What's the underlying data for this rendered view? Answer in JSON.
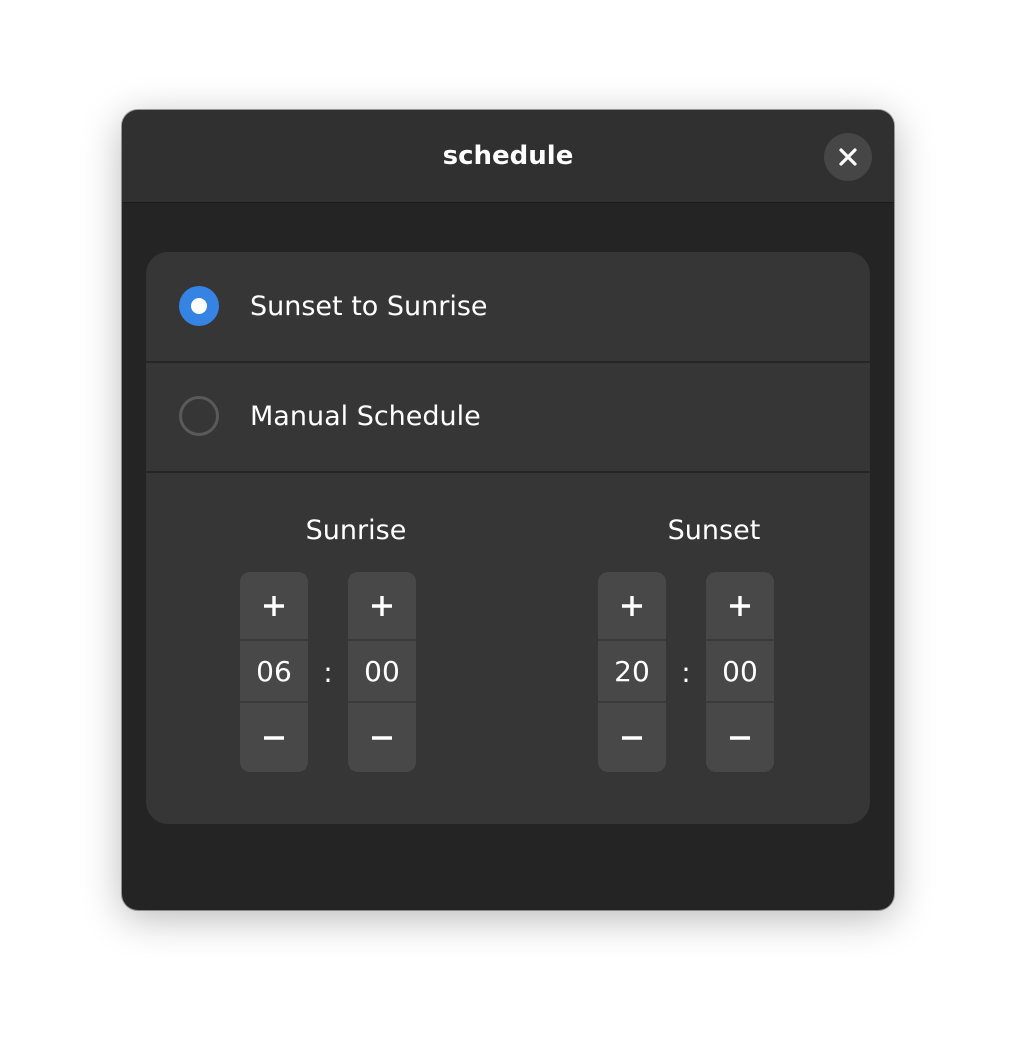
{
  "window": {
    "title": "schedule"
  },
  "options": [
    {
      "label": "Sunset to Sunrise",
      "selected": true
    },
    {
      "label": "Manual Schedule",
      "selected": false
    }
  ],
  "sunrise": {
    "label": "Sunrise",
    "hour": "06",
    "minute": "00",
    "separator": ":"
  },
  "sunset": {
    "label": "Sunset",
    "hour": "20",
    "minute": "00",
    "separator": ":"
  },
  "colors": {
    "accent": "#3584e4",
    "window_bg": "#242424",
    "card_bg": "#363636",
    "spin_bg": "#484848"
  },
  "icons": {
    "close": "close-icon",
    "increment": "plus-icon",
    "decrement": "minus-icon"
  }
}
